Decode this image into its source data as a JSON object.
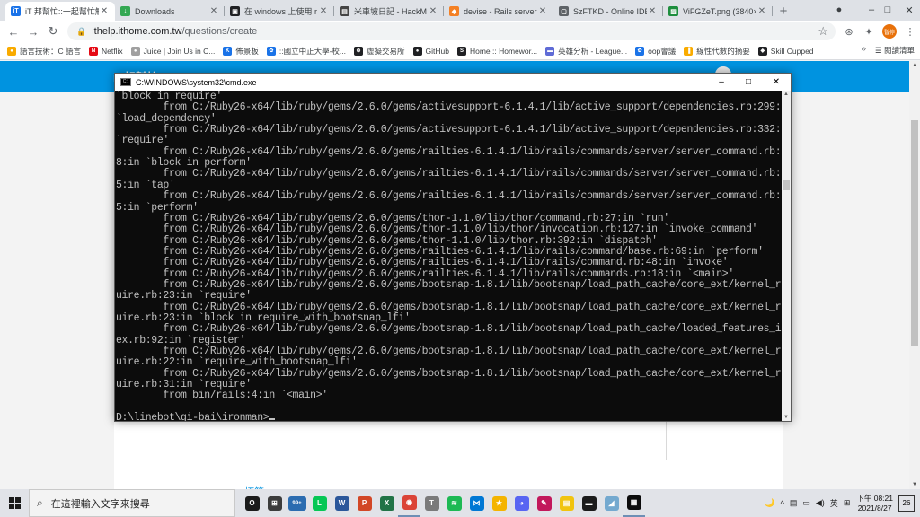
{
  "browser": {
    "tabs": [
      {
        "title": "iT 邦幫忙::一起幫忙解",
        "color": "#1a73e8",
        "glyph": "iT",
        "active": true
      },
      {
        "title": "Downloads",
        "color": "#34a853",
        "glyph": "↓",
        "active": false
      },
      {
        "title": "在 windows 上使用 r",
        "color": "#202124",
        "glyph": "▣",
        "active": false
      },
      {
        "title": "米車坡日記 - HackM",
        "color": "#444444",
        "glyph": "▤",
        "active": false
      },
      {
        "title": "devise - Rails server",
        "color": "#f48024",
        "glyph": "◆",
        "active": false
      },
      {
        "title": "SzFTKD - Online IDE",
        "color": "#5f6368",
        "glyph": "▢",
        "active": false
      },
      {
        "title": "ViFGZeT.png (3840×",
        "color": "#1e8e3e",
        "glyph": "▨",
        "active": false
      }
    ],
    "new_tab": "+",
    "window_controls": {
      "minimize": "–",
      "maximize": "□",
      "close": "✕"
    },
    "nav": {
      "back": "←",
      "forward": "→",
      "reload": "↻"
    },
    "address": {
      "lock": "🔒",
      "host": "ithelp.ithome.com.tw",
      "path": "/questions/create"
    },
    "bookmark_star": "☆",
    "profile_label": "暫停",
    "bookmarks": [
      {
        "label": "語言技術：C 語言",
        "color": "#f9ab00",
        "glyph": "●"
      },
      {
        "label": "Netflix",
        "color": "#e50914",
        "glyph": "N"
      },
      {
        "label": "Juice | Join Us in C...",
        "color": "#a0a0a0",
        "glyph": "●"
      },
      {
        "label": "佈景板",
        "color": "#1a73e8",
        "glyph": "K"
      },
      {
        "label": "::國立中正大學-校...",
        "color": "#1a73e8",
        "glyph": "✿"
      },
      {
        "label": "虛擬交易所",
        "color": "#202124",
        "glyph": "⊕"
      },
      {
        "label": "GitHub",
        "color": "#202124",
        "glyph": "●"
      },
      {
        "label": "Home :: Homewor...",
        "color": "#202124",
        "glyph": "S"
      },
      {
        "label": "英雄分析 - League...",
        "color": "#5f6bd6",
        "glyph": "▬"
      },
      {
        "label": "oop會議",
        "color": "#1a73e8",
        "glyph": "✿"
      },
      {
        "label": "線性代數的摘要",
        "color": "#f9ab00",
        "glyph": "▐"
      },
      {
        "label": "Skill Cupped",
        "color": "#202124",
        "glyph": "◆"
      }
    ],
    "bookmarks_more": "»",
    "reading_list": "閱讀清單"
  },
  "page": {
    "site_logo": "iT邦幫忙",
    "tags_label": "標籤"
  },
  "cmd": {
    "title": "C:\\WINDOWS\\system32\\cmd.exe",
    "lines": [
      "`block in require'",
      "        from C:/Ruby26-x64/lib/ruby/gems/2.6.0/gems/activesupport-6.1.4.1/lib/active_support/dependencies.rb:299:in",
      "`load_dependency'",
      "        from C:/Ruby26-x64/lib/ruby/gems/2.6.0/gems/activesupport-6.1.4.1/lib/active_support/dependencies.rb:332:in",
      "`require'",
      "        from C:/Ruby26-x64/lib/ruby/gems/2.6.0/gems/railties-6.1.4.1/lib/rails/commands/server/server_command.rb:13",
      "8:in `block in perform'",
      "        from C:/Ruby26-x64/lib/ruby/gems/2.6.0/gems/railties-6.1.4.1/lib/rails/commands/server/server_command.rb:13",
      "5:in `tap'",
      "        from C:/Ruby26-x64/lib/ruby/gems/2.6.0/gems/railties-6.1.4.1/lib/rails/commands/server/server_command.rb:13",
      "5:in `perform'",
      "        from C:/Ruby26-x64/lib/ruby/gems/2.6.0/gems/thor-1.1.0/lib/thor/command.rb:27:in `run'",
      "        from C:/Ruby26-x64/lib/ruby/gems/2.6.0/gems/thor-1.1.0/lib/thor/invocation.rb:127:in `invoke_command'",
      "        from C:/Ruby26-x64/lib/ruby/gems/2.6.0/gems/thor-1.1.0/lib/thor.rb:392:in `dispatch'",
      "        from C:/Ruby26-x64/lib/ruby/gems/2.6.0/gems/railties-6.1.4.1/lib/rails/command/base.rb:69:in `perform'",
      "        from C:/Ruby26-x64/lib/ruby/gems/2.6.0/gems/railties-6.1.4.1/lib/rails/command.rb:48:in `invoke'",
      "        from C:/Ruby26-x64/lib/ruby/gems/2.6.0/gems/railties-6.1.4.1/lib/rails/commands.rb:18:in `<main>'",
      "        from C:/Ruby26-x64/lib/ruby/gems/2.6.0/gems/bootsnap-1.8.1/lib/bootsnap/load_path_cache/core_ext/kernel_req",
      "uire.rb:23:in `require'",
      "        from C:/Ruby26-x64/lib/ruby/gems/2.6.0/gems/bootsnap-1.8.1/lib/bootsnap/load_path_cache/core_ext/kernel_req",
      "uire.rb:23:in `block in require_with_bootsnap_lfi'",
      "        from C:/Ruby26-x64/lib/ruby/gems/2.6.0/gems/bootsnap-1.8.1/lib/bootsnap/load_path_cache/loaded_features_ind",
      "ex.rb:92:in `register'",
      "        from C:/Ruby26-x64/lib/ruby/gems/2.6.0/gems/bootsnap-1.8.1/lib/bootsnap/load_path_cache/core_ext/kernel_req",
      "uire.rb:22:in `require_with_bootsnap_lfi'",
      "        from C:/Ruby26-x64/lib/ruby/gems/2.6.0/gems/bootsnap-1.8.1/lib/bootsnap/load_path_cache/core_ext/kernel_req",
      "uire.rb:31:in `require'",
      "        from bin/rails:4:in `<main>'",
      "",
      "D:\\linebot\\gi-bai\\ironman>"
    ]
  },
  "taskbar": {
    "search_placeholder": "在這裡輸入文字來搜尋",
    "apps": [
      {
        "name": "cortana",
        "color": "#1b1b1b",
        "glyph": "O"
      },
      {
        "name": "task-view",
        "color": "#3c3c3c",
        "glyph": "⊞"
      },
      {
        "name": "store",
        "color": "#2b6cb0",
        "glyph": "99+"
      },
      {
        "name": "line",
        "color": "#06c755",
        "glyph": "L"
      },
      {
        "name": "word",
        "color": "#2b579a",
        "glyph": "W"
      },
      {
        "name": "powerpoint",
        "color": "#d24726",
        "glyph": "P"
      },
      {
        "name": "excel",
        "color": "#217346",
        "glyph": "X"
      },
      {
        "name": "chrome",
        "color": "#db4437",
        "glyph": "◉"
      },
      {
        "name": "typora",
        "color": "#7a7a7a",
        "glyph": "T"
      },
      {
        "name": "spotify",
        "color": "#1db954",
        "glyph": "≋"
      },
      {
        "name": "vscode",
        "color": "#0078d4",
        "glyph": "⋈"
      },
      {
        "name": "game",
        "color": "#f4b400",
        "glyph": "★"
      },
      {
        "name": "discord",
        "color": "#5865f2",
        "glyph": "◕"
      },
      {
        "name": "paint",
        "color": "#c2185b",
        "glyph": "✎"
      },
      {
        "name": "notes",
        "color": "#f1c40f",
        "glyph": "▤"
      },
      {
        "name": "terminal",
        "color": "#1b1b1b",
        "glyph": "▬"
      },
      {
        "name": "sky",
        "color": "#74a9cf",
        "glyph": "◢"
      },
      {
        "name": "cmd",
        "color": "#0c0c0c",
        "glyph": "▦"
      }
    ],
    "tray": {
      "weather": "🌙",
      "chevron": "^",
      "ime": "英",
      "date_box": "26",
      "time": "下午 08:21",
      "date": "2021/8/27"
    }
  }
}
